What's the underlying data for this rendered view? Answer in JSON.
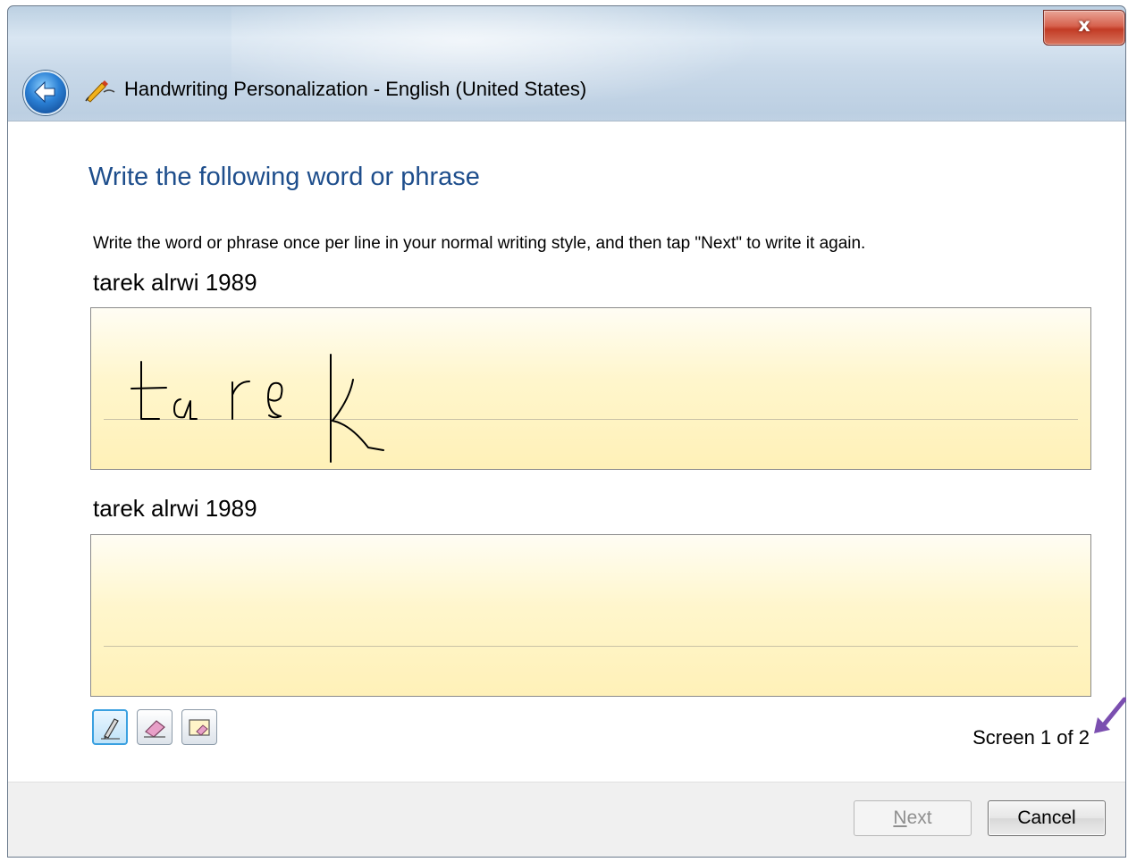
{
  "window": {
    "title": "Handwriting Personalization - English (United States)",
    "close_label": "x"
  },
  "content": {
    "heading": "Write the following word or phrase",
    "instruction": "Write the word or phrase once per line in your normal writing style, and then tap \"Next\" to write it again.",
    "lines": [
      {
        "phrase": "tarek alrwi 1989",
        "has_ink": true
      },
      {
        "phrase": "tarek alrwi 1989",
        "has_ink": false
      }
    ],
    "tools": [
      {
        "name": "pen",
        "icon": "pen-icon",
        "active": true
      },
      {
        "name": "eraser",
        "icon": "eraser-icon",
        "active": false
      },
      {
        "name": "clear",
        "icon": "clear-pad-icon",
        "active": false
      }
    ],
    "screen_counter": "Screen 1 of 2"
  },
  "footer": {
    "next_access_key": "N",
    "next_rest": "ext",
    "next_enabled": false,
    "cancel_label": "Cancel"
  },
  "colors": {
    "heading": "#1e4e8c",
    "pad_fill": "#fff6cc",
    "annotation_arrow": "#7b4fb0"
  }
}
